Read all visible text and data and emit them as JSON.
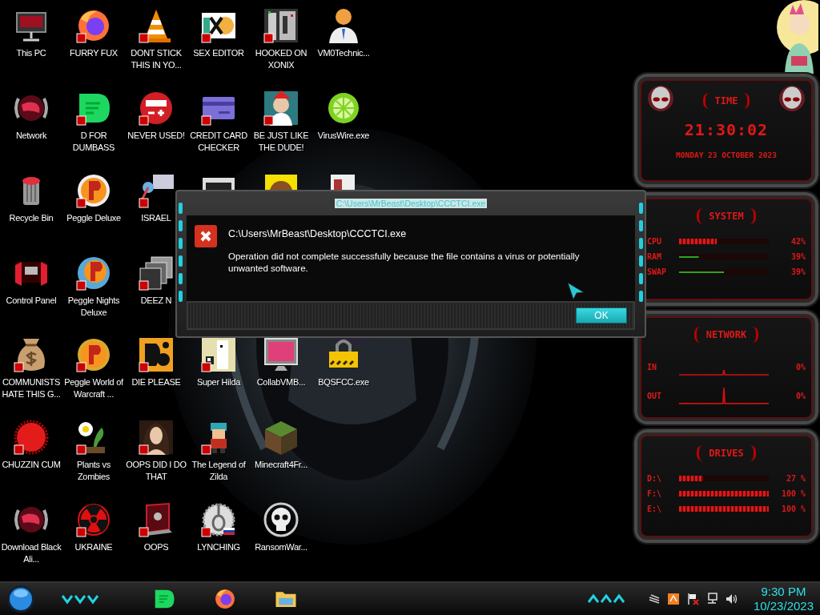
{
  "desktop": {
    "rows": [
      [
        {
          "kind": "shortcut",
          "label": "This PC"
        },
        {
          "kind": "shortcut",
          "label": "FURRY FUX"
        },
        {
          "kind": "shortcut",
          "label": "DONT STICK THIS IN YO..."
        },
        {
          "kind": "shortcut",
          "label": "SEX EDITOR"
        },
        {
          "kind": "shortcut",
          "label": "HOOKED ON XONIX"
        },
        {
          "kind": "shortcut",
          "label": "VM0Technic..."
        }
      ],
      [
        {
          "kind": "shortcut",
          "label": "Network"
        },
        {
          "kind": "shortcut",
          "label": "D FOR DUMBASS"
        },
        {
          "kind": "shortcut",
          "label": "NEVER USED!"
        },
        {
          "kind": "shortcut",
          "label": "CREDIT CARD CHECKER"
        },
        {
          "kind": "shortcut",
          "label": "BE JUST LIKE THE DUDE!"
        },
        {
          "kind": "shortcut",
          "label": "VirusWire.exe"
        }
      ],
      [
        {
          "kind": "shortcut",
          "label": "Recycle Bin"
        },
        {
          "kind": "shortcut",
          "label": "Peggle Deluxe"
        },
        {
          "kind": "shortcut",
          "label": "ISRAEL"
        },
        {
          "kind": "covered"
        },
        {
          "kind": "covered"
        },
        {
          "kind": "covered"
        }
      ],
      [
        {
          "kind": "shortcut",
          "label": "Control Panel"
        },
        {
          "kind": "shortcut",
          "label": "Peggle Nights Deluxe"
        },
        {
          "kind": "shortcut",
          "label": "DEEZ N"
        }
      ],
      [
        {
          "kind": "shortcut",
          "label": "COMMUNISTS HATE THIS G..."
        },
        {
          "kind": "shortcut",
          "label": "Peggle World of Warcraft ..."
        },
        {
          "kind": "shortcut",
          "label": "DIE PLEASE"
        },
        {
          "kind": "shortcut",
          "label": "Super Hilda"
        },
        {
          "kind": "shortcut",
          "label": "CollabVMB..."
        },
        {
          "kind": "shortcut",
          "label": "BQSFCC.exe"
        }
      ],
      [
        {
          "kind": "shortcut",
          "label": "CHUZZIN CUM"
        },
        {
          "kind": "shortcut",
          "label": "Plants vs Zombies"
        },
        {
          "kind": "shortcut",
          "label": "OOPS DID I DO THAT"
        },
        {
          "kind": "shortcut",
          "label": "The Legend of Zilda"
        },
        {
          "kind": "shortcut",
          "label": "Minecraft4Fr..."
        }
      ],
      [
        {
          "kind": "shortcut",
          "label": "Download Black Ali..."
        },
        {
          "kind": "shortcut",
          "label": "UKRAINE"
        },
        {
          "kind": "shortcut",
          "label": "OOPS"
        },
        {
          "kind": "shortcut",
          "label": "LYNCHING"
        },
        {
          "kind": "shortcut",
          "label": "RansomWar..."
        }
      ]
    ]
  },
  "dialog": {
    "title": "C:\\Users\\MrBeast\\Desktop\\CCCTCI.exe",
    "heading": "C:\\Users\\MrBeast\\Desktop\\CCCTCI.exe",
    "message": "Operation did not complete successfully because the file contains a virus or potentially unwanted software.",
    "buttons": [
      "OK"
    ]
  },
  "gadgets": {
    "time": {
      "title": "TIME",
      "clock": "21:30:02",
      "date": "MONDAY 23 OCTOBER 2023"
    },
    "system": {
      "title": "SYSTEM",
      "meters": [
        {
          "name": "CPU",
          "kind": "chevrons",
          "level": 0.42,
          "reading": "42%"
        },
        {
          "name": "RAM",
          "kind": "line",
          "reading": "39%"
        },
        {
          "name": "SWAP",
          "kind": "line",
          "reading": "39%"
        }
      ]
    },
    "network": {
      "title": "NETWORK",
      "channels": [
        {
          "name": "IN",
          "reading": "0%"
        },
        {
          "name": "OUT",
          "reading": "0%"
        }
      ]
    },
    "drives": {
      "title": "DRIVES",
      "drives": [
        {
          "name": "D:\\",
          "level": 0.27,
          "reading": "27 %"
        },
        {
          "name": "F:\\",
          "level": 1,
          "reading": "100 %"
        },
        {
          "name": "E:\\",
          "level": 1,
          "reading": "100 %"
        }
      ]
    }
  },
  "taskbar": {
    "clock": {
      "time": "9:30 PM",
      "date": "10/23/2023"
    }
  }
}
